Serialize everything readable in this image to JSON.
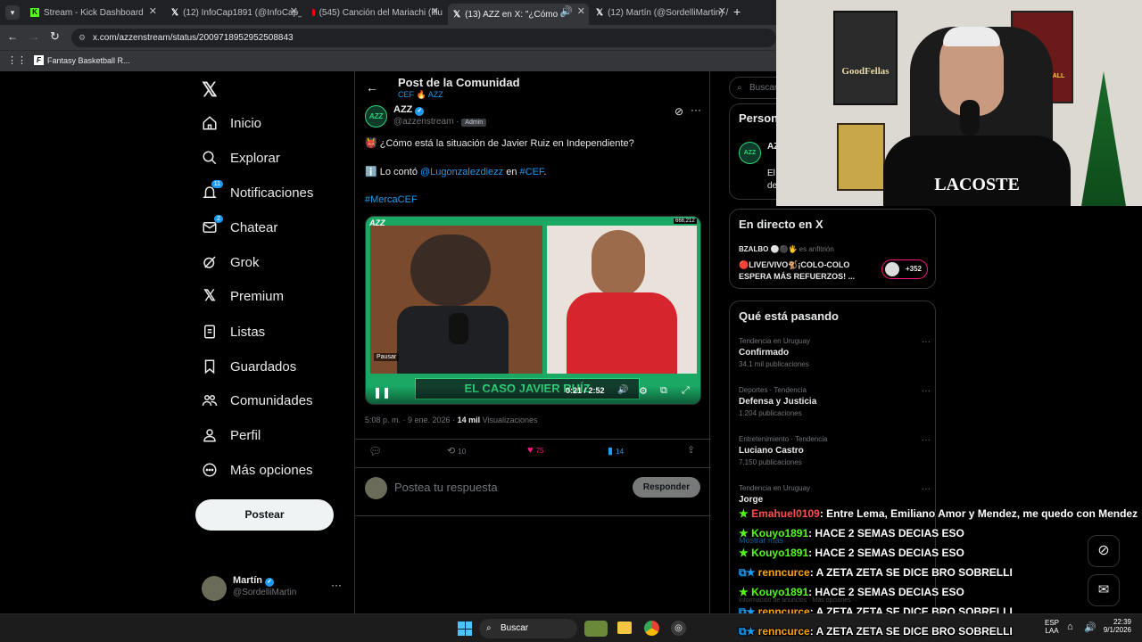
{
  "browser": {
    "tabs": [
      {
        "title": "Stream - Kick Dashboard",
        "favicon": "kick-icon"
      },
      {
        "title": "(12) InfoCap1891 (@InfoCap_1(",
        "favicon": "x-icon"
      },
      {
        "title": "(545) Canción del Mariachi (Illu",
        "favicon": "youtube-icon"
      },
      {
        "title": "(13) AZZ en X: \"¿Cómo e",
        "favicon": "x-icon"
      },
      {
        "title": "(12) Martín (@SordelliMartin) /",
        "favicon": "x-icon"
      }
    ],
    "new_tab": "+",
    "url": "x.com/azzenstream/status/2009718952952508843",
    "bookmark": "Fantasy Basketball R..."
  },
  "nav": {
    "items": [
      {
        "label": "Inicio",
        "icon": "home-icon"
      },
      {
        "label": "Explorar",
        "icon": "search-icon"
      },
      {
        "label": "Notificaciones",
        "icon": "bell-icon",
        "badge": "11"
      },
      {
        "label": "Chatear",
        "icon": "mail-icon",
        "badge": "2"
      },
      {
        "label": "Grok",
        "icon": "grok-icon"
      },
      {
        "label": "Premium",
        "icon": "x-logo-icon"
      },
      {
        "label": "Listas",
        "icon": "list-icon"
      },
      {
        "label": "Guardados",
        "icon": "bookmark-icon"
      },
      {
        "label": "Comunidades",
        "icon": "communities-icon"
      },
      {
        "label": "Perfil",
        "icon": "person-icon"
      },
      {
        "label": "Más opciones",
        "icon": "more-icon"
      }
    ],
    "post_button": "Postear",
    "account": {
      "name": "Martín",
      "handle": "@SordelliMartin"
    }
  },
  "post": {
    "header_title": "Post de la Comunidad",
    "community": "CEF 🔥 AZZ",
    "author_name": "AZZ",
    "author_handle": "@azzenstream",
    "author_badge": "Admin",
    "avatar_text": "AZZ",
    "line1": "👹 ¿Cómo está la situación de Javier Ruiz en Independiente?",
    "line2_prefix": "ℹ️ Lo contó",
    "line2_mention": "@Lugonzalezdiezz",
    "line2_mid": "en",
    "line2_tag": "#CEF",
    "line2_end": ".",
    "hashtag": "#MercaCEF",
    "video": {
      "pause_label": "Pausar",
      "banner": "EL CASO JAVIER RUÍZ",
      "time": "0:21 / 2:52",
      "views_badge": "666,212"
    },
    "timestamp": "5:08 p. m. · 9 ene. 2026 ·",
    "views": "14 mil",
    "views_label": "Visualizaciones",
    "replies": "",
    "reposts": "10",
    "likes": "75",
    "bookmarks": "14",
    "reply_placeholder": "Postea tu respuesta",
    "reply_button": "Responder"
  },
  "right": {
    "search_placeholder": "Buscar",
    "persons_title": "Person",
    "persons_avatar": "AZZ",
    "persons_name": "AZ",
    "persons_line1": "El",
    "persons_line2": "de",
    "live_title": "En directo en X",
    "live_host": "BZALBO ⚪⚫🖐",
    "live_host_suffix": "es anfitrión",
    "live_text": "🔴LIVE/VIVO🐒¡COLO-COLO ESPERA MÁS REFUERZOS! ...",
    "live_count": "+352",
    "trends_title": "Qué está pasando",
    "trends": [
      {
        "meta": "Tendencia en Uruguay",
        "name": "Confirmado",
        "count": "34,1 mil publicaciones"
      },
      {
        "meta": "Deportes · Tendencia",
        "name": "Defensa y Justicia",
        "count": "1.204 publicaciones"
      },
      {
        "meta": "Entretenimiento · Tendencia",
        "name": "Luciano Castro",
        "count": "7.150 publicaciones"
      },
      {
        "meta": "Tendencia en Uruguay",
        "name": "Jorge",
        "count": ""
      }
    ],
    "show_more": "Mostrar más",
    "footer": "Información de anuncios · Más opciones ···"
  },
  "webcam": {
    "poster1": "GoodFellas",
    "poster2": "BETTER CALL SAUL",
    "shirt": "LACOSTE"
  },
  "chat": [
    {
      "user": "Emahuel0109",
      "msg": ": Entre Lema, Emiliano Amor y Mendez, me quedo con Mendez",
      "color": "red"
    },
    {
      "user": "Kouyo1891",
      "msg": ": HACE 2 SEMAS DECIAS ESO",
      "color": "green"
    },
    {
      "user": "Kouyo1891",
      "msg": ": HACE 2 SEMAS DECIAS ESO",
      "color": "green"
    },
    {
      "user": "renncurce",
      "msg": ": A ZETA ZETA SE DICE BRO SOBRELLI",
      "color": "orange"
    },
    {
      "user": "Kouyo1891",
      "msg": ": HACE 2 SEMAS DECIAS ESO",
      "color": "green"
    },
    {
      "user": "renncurce",
      "msg": ": A ZETA ZETA SE DICE BRO SOBRELLI",
      "color": "orange"
    },
    {
      "user": "renncurce",
      "msg": ": A ZETA ZETA SE DICE BRO SOBRELLI",
      "color": "orange"
    }
  ],
  "taskbar": {
    "search": "Buscar",
    "lang": "ESP",
    "lang2": "LAA",
    "time": "22:39",
    "date": "9/1/2026"
  }
}
